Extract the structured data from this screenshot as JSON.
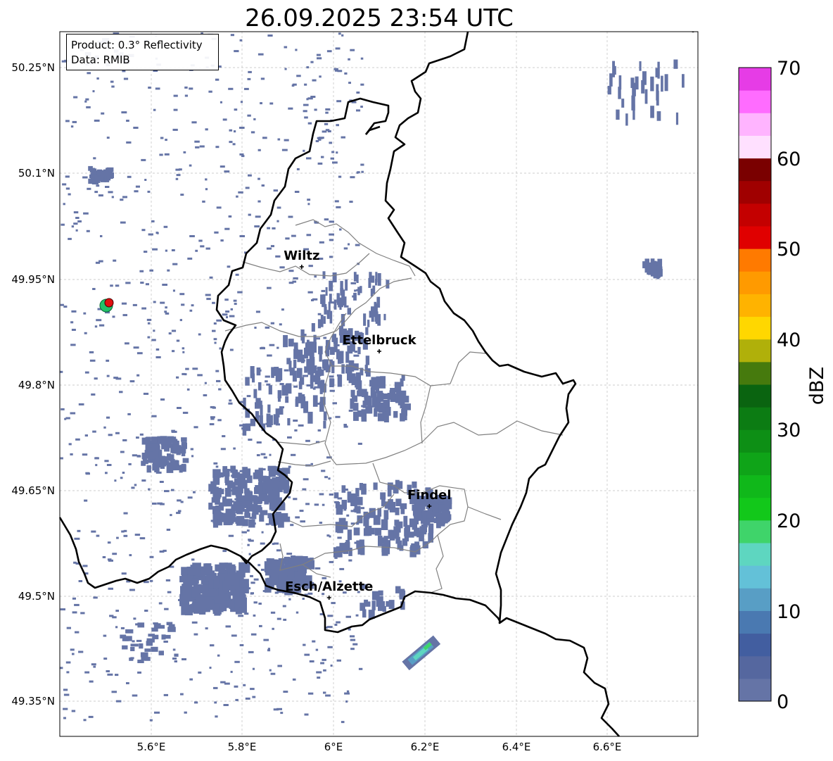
{
  "title": "26.09.2025 23:54 UTC",
  "info": {
    "product": "Product: 0.3° Reflectivity",
    "source": "Data: RMIB"
  },
  "map": {
    "lon_range": [
      5.4,
      6.8
    ],
    "lat_range": [
      49.3,
      50.3
    ],
    "x_ticks": [
      "5.6°E",
      "5.8°E",
      "6°E",
      "6.2°E",
      "6.4°E",
      "6.6°E"
    ],
    "y_ticks": [
      "50.25°N",
      "50.1°N",
      "49.95°N",
      "49.8°N",
      "49.65°N",
      "49.5°N",
      "49.35°N"
    ],
    "grid": true,
    "radar_site_color": "#e01010",
    "cities": [
      {
        "name": "Wiltz",
        "lon": 5.93,
        "lat": 49.967
      },
      {
        "name": "Ettelbruck",
        "lon": 6.1,
        "lat": 49.847
      },
      {
        "name": "Findel",
        "lon": 6.21,
        "lat": 49.627
      },
      {
        "name": "Esch/Alzette",
        "lon": 5.99,
        "lat": 49.497
      }
    ]
  },
  "colorbar": {
    "label": "dBZ",
    "ticks": [
      "0",
      "10",
      "20",
      "30",
      "40",
      "50",
      "60",
      "70"
    ],
    "min": 0,
    "max": 70,
    "step": 2.5,
    "colors": [
      "#6574a6",
      "#55679f",
      "#425ea0",
      "#4a79b1",
      "#589ec5",
      "#63c1d8",
      "#5ed6c0",
      "#3fd46a",
      "#12c81a",
      "#10b81a",
      "#0fa418",
      "#0d8f15",
      "#0c7c13",
      "#0a6410",
      "#467a0d",
      "#b0b00a",
      "#ffd700",
      "#ffb300",
      "#ff9a00",
      "#ff7a00",
      "#e00000",
      "#c40000",
      "#a00000",
      "#7a0000",
      "#ffe0ff",
      "#ffb4ff",
      "#ff6cff",
      "#e63ce6"
    ]
  }
}
